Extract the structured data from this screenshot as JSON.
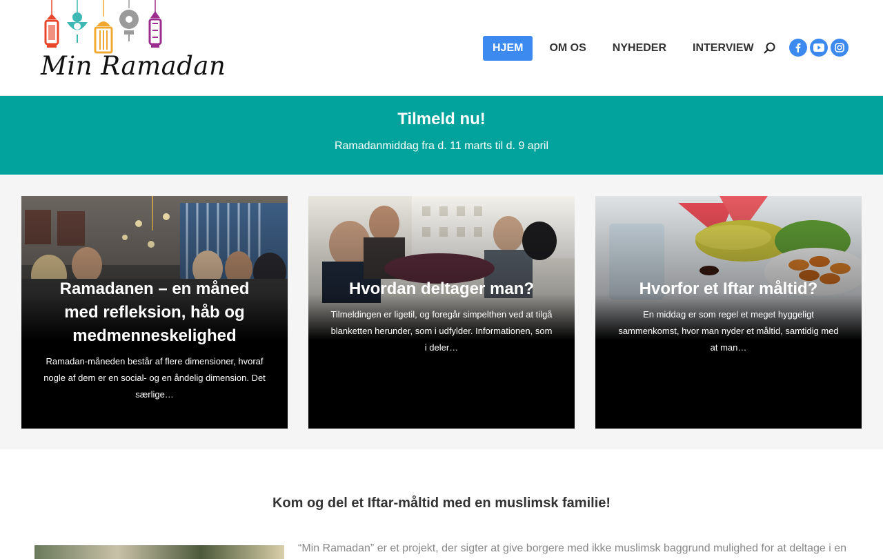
{
  "site": {
    "logo_text": "Min Ramadan"
  },
  "nav": {
    "items": [
      {
        "label": "HJEM",
        "active": true
      },
      {
        "label": "OM OS",
        "active": false
      },
      {
        "label": "NYHEDER",
        "active": false
      },
      {
        "label": "INTERVIEW",
        "active": false
      }
    ],
    "icons": [
      "search-icon",
      "facebook-icon",
      "youtube-icon",
      "instagram-icon"
    ],
    "accent_color": "#3c89f0"
  },
  "banner": {
    "title": "Tilmeld nu!",
    "subtitle": "Ramadanmiddag fra d. 11 marts til d. 9 april",
    "color": "#01a39c"
  },
  "cards": [
    {
      "title": "Ramadanen – en måned med refleksion, håb og medmenneskelighed",
      "excerpt": "Ramadan-måneden består af flere dimensioner, hvoraf nogle af dem er en social- og en åndelig dimension. Det særlige…"
    },
    {
      "title": "Hvordan deltager man?",
      "excerpt": "Tilmeldingen er ligetil, og foregår simpelthen ved at tilgå blanketten herunder, som i udfylder. Informationen, som i deler…"
    },
    {
      "title": "Hvorfor et Iftar måltid?",
      "excerpt": "En middag er som regel et meget hyggeligt sammenkomst, hvor man nyder et måltid, samtidig med at man…"
    }
  ],
  "intro": {
    "heading": "Kom og del et Iftar-måltid med en muslimsk familie!",
    "text": "“Min Ramadan” er et projekt, der sigter at give borgere med ikke muslimsk baggrund mulighed for at deltage i en"
  }
}
